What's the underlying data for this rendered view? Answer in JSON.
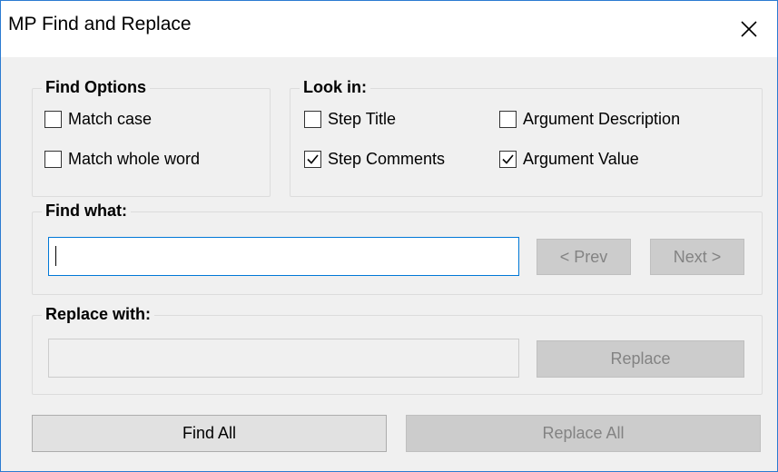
{
  "window": {
    "title": "MP Find and Replace",
    "close_icon": "close-icon"
  },
  "find_options": {
    "legend": "Find Options",
    "match_case": {
      "label": "Match case",
      "checked": false
    },
    "match_whole_word": {
      "label": "Match whole word",
      "checked": false
    }
  },
  "look_in": {
    "legend": "Look in:",
    "step_title": {
      "label": "Step Title",
      "checked": false
    },
    "argument_description": {
      "label": "Argument Description",
      "checked": false
    },
    "step_comments": {
      "label": "Step Comments",
      "checked": true
    },
    "argument_value": {
      "label": "Argument Value",
      "checked": true
    }
  },
  "find_what": {
    "legend": "Find what:",
    "value": "",
    "prev_label": "< Prev",
    "next_label": "Next >"
  },
  "replace_with": {
    "legend": "Replace with:",
    "value": "",
    "replace_label": "Replace"
  },
  "footer": {
    "find_all_label": "Find All",
    "replace_all_label": "Replace All"
  },
  "colors": {
    "accent": "#0078d7",
    "disabled_text": "#838383"
  }
}
